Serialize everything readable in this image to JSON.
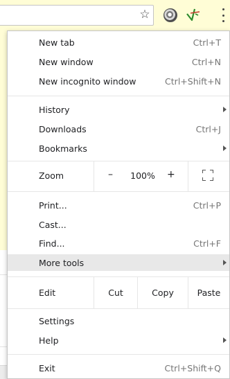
{
  "toolbar": {
    "icons": [
      "star-icon",
      "extension-icon",
      "extension-icon",
      "menu-kebab-icon"
    ],
    "star_glyph": "☆"
  },
  "menu": {
    "new_tab": {
      "label": "New tab",
      "shortcut": "Ctrl+T"
    },
    "new_window": {
      "label": "New window",
      "shortcut": "Ctrl+N"
    },
    "new_incognito": {
      "label": "New incognito window",
      "shortcut": "Ctrl+Shift+N"
    },
    "history": {
      "label": "History"
    },
    "downloads": {
      "label": "Downloads",
      "shortcut": "Ctrl+J"
    },
    "bookmarks": {
      "label": "Bookmarks"
    },
    "zoom": {
      "label": "Zoom",
      "minus": "–",
      "value": "100%",
      "plus": "+"
    },
    "print": {
      "label": "Print...",
      "shortcut": "Ctrl+P"
    },
    "cast": {
      "label": "Cast..."
    },
    "find": {
      "label": "Find...",
      "shortcut": "Ctrl+F"
    },
    "more_tools": {
      "label": "More tools"
    },
    "edit": {
      "label": "Edit",
      "cut": "Cut",
      "copy": "Copy",
      "paste": "Paste"
    },
    "settings": {
      "label": "Settings"
    },
    "help": {
      "label": "Help"
    },
    "exit": {
      "label": "Exit",
      "shortcut": "Ctrl+Shift+Q"
    }
  },
  "colors": {
    "page_background": "#fffdd6",
    "menu_background": "#ffffff",
    "highlight": "#e8e8e8",
    "shortcut_text": "#757575",
    "extension_green": "#2e8b2e"
  }
}
